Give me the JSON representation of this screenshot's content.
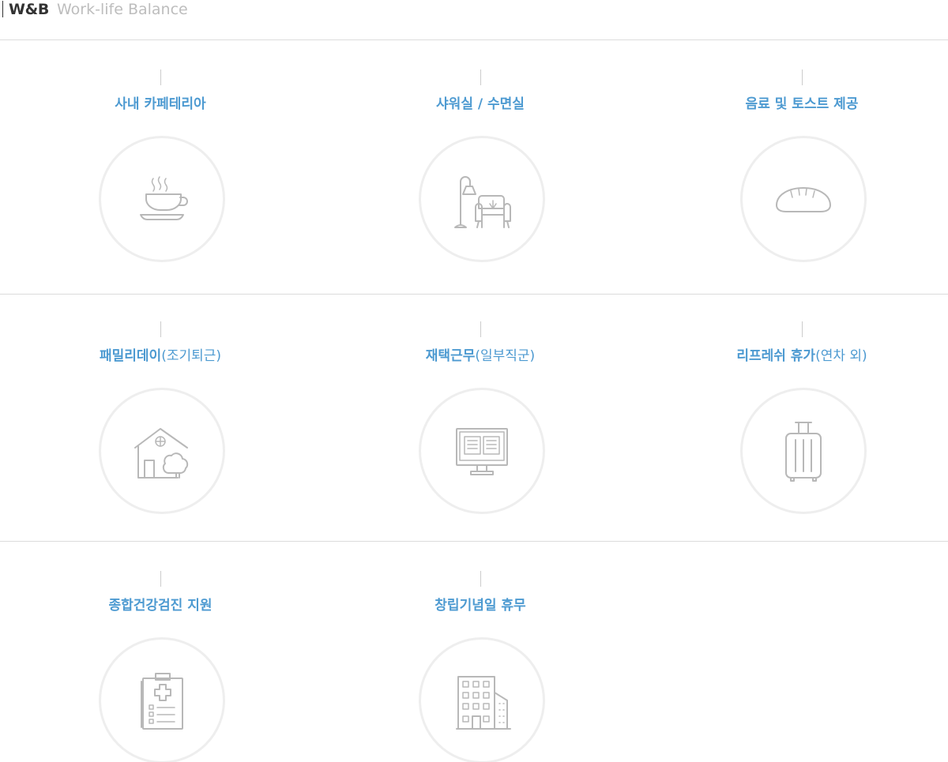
{
  "header": {
    "title": "W&B",
    "subtitle": "Work-life Balance"
  },
  "benefits": [
    {
      "label_bold": "사내 카페테리아",
      "label_paren": "",
      "icon": "coffee-cup-icon"
    },
    {
      "label_bold": "샤워실 / 수면실",
      "label_paren": "",
      "icon": "lounge-chair-lamp-icon"
    },
    {
      "label_bold": "음료 및 토스트 제공",
      "label_paren": "",
      "icon": "bread-icon"
    },
    {
      "label_bold": "패밀리데이",
      "label_paren": "(조기퇴근)",
      "icon": "house-tree-icon"
    },
    {
      "label_bold": "재택근무",
      "label_paren": "(일부직군)",
      "icon": "monitor-book-icon"
    },
    {
      "label_bold": "리프레쉬 휴가",
      "label_paren": "(연차 외)",
      "icon": "suitcase-icon"
    },
    {
      "label_bold": "종합건강검진 지원",
      "label_paren": "",
      "icon": "medical-clipboard-icon"
    },
    {
      "label_bold": "창립기념일 휴무",
      "label_paren": "",
      "icon": "office-building-icon"
    }
  ],
  "colors": {
    "accent": "#4d9ad1",
    "icon": "#b8b8b8",
    "circle_border": "#eeeeee",
    "divider": "#dcdcdc"
  }
}
